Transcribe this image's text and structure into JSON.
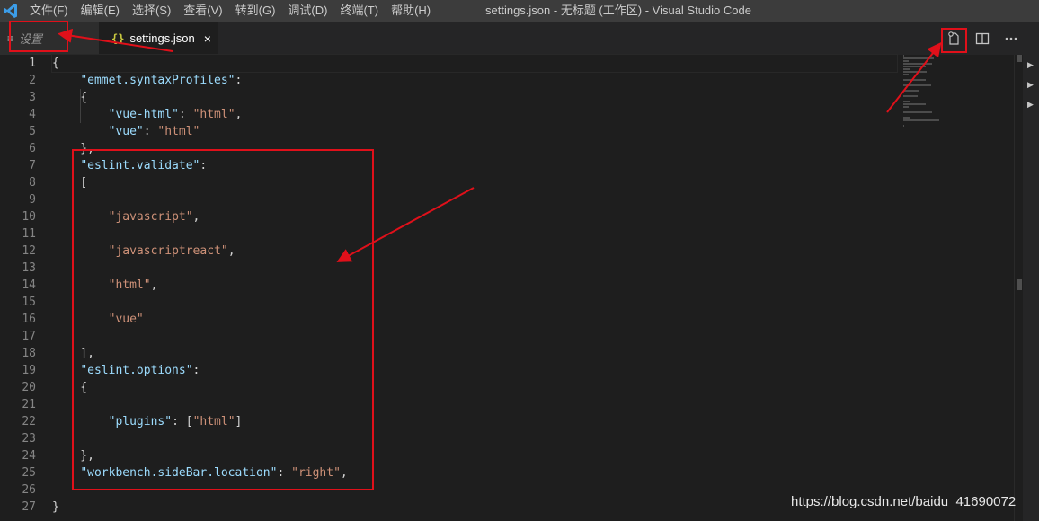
{
  "titlebar": {
    "menu": [
      "文件(F)",
      "编辑(E)",
      "选择(S)",
      "查看(V)",
      "转到(G)",
      "调试(D)",
      "终端(T)",
      "帮助(H)"
    ],
    "window_title": "settings.json - 无标题 (工作区) - Visual Studio Code"
  },
  "tabs": {
    "settings_ui": "设置",
    "settings_json": "settings.json",
    "json_icon": "{}",
    "close": "×"
  },
  "editor": {
    "line_numbers": [
      "1",
      "2",
      "3",
      "4",
      "5",
      "6",
      "7",
      "8",
      "9",
      "10",
      "11",
      "12",
      "13",
      "14",
      "15",
      "16",
      "17",
      "18",
      "19",
      "20",
      "21",
      "22",
      "23",
      "24",
      "25",
      "26",
      "27"
    ],
    "lines": [
      [
        {
          "t": "p",
          "v": "{"
        }
      ],
      [
        {
          "t": "p",
          "v": "    "
        },
        {
          "t": "k",
          "v": "\"emmet.syntaxProfiles\""
        },
        {
          "t": "p",
          "v": ": "
        }
      ],
      [
        {
          "t": "p",
          "v": "    {"
        }
      ],
      [
        {
          "t": "p",
          "v": "        "
        },
        {
          "t": "k",
          "v": "\"vue-html\""
        },
        {
          "t": "p",
          "v": ": "
        },
        {
          "t": "s",
          "v": "\"html\""
        },
        {
          "t": "p",
          "v": ","
        }
      ],
      [
        {
          "t": "p",
          "v": "        "
        },
        {
          "t": "k",
          "v": "\"vue\""
        },
        {
          "t": "p",
          "v": ": "
        },
        {
          "t": "s",
          "v": "\"html\""
        }
      ],
      [
        {
          "t": "p",
          "v": "    },"
        }
      ],
      [
        {
          "t": "p",
          "v": "    "
        },
        {
          "t": "k",
          "v": "\"eslint.validate\""
        },
        {
          "t": "p",
          "v": ":"
        }
      ],
      [
        {
          "t": "p",
          "v": "    ["
        }
      ],
      [
        {
          "t": "p",
          "v": ""
        }
      ],
      [
        {
          "t": "p",
          "v": "        "
        },
        {
          "t": "s",
          "v": "\"javascript\""
        },
        {
          "t": "p",
          "v": ","
        }
      ],
      [
        {
          "t": "p",
          "v": ""
        }
      ],
      [
        {
          "t": "p",
          "v": "        "
        },
        {
          "t": "s",
          "v": "\"javascriptreact\""
        },
        {
          "t": "p",
          "v": ","
        }
      ],
      [
        {
          "t": "p",
          "v": ""
        }
      ],
      [
        {
          "t": "p",
          "v": "        "
        },
        {
          "t": "s",
          "v": "\"html\""
        },
        {
          "t": "p",
          "v": ","
        }
      ],
      [
        {
          "t": "p",
          "v": ""
        }
      ],
      [
        {
          "t": "p",
          "v": "        "
        },
        {
          "t": "s",
          "v": "\"vue\""
        }
      ],
      [
        {
          "t": "p",
          "v": ""
        }
      ],
      [
        {
          "t": "p",
          "v": "    ],"
        }
      ],
      [
        {
          "t": "p",
          "v": "    "
        },
        {
          "t": "k",
          "v": "\"eslint.options\""
        },
        {
          "t": "p",
          "v": ":"
        }
      ],
      [
        {
          "t": "p",
          "v": "    {"
        }
      ],
      [
        {
          "t": "p",
          "v": ""
        }
      ],
      [
        {
          "t": "p",
          "v": "        "
        },
        {
          "t": "k",
          "v": "\"plugins\""
        },
        {
          "t": "p",
          "v": ": ["
        },
        {
          "t": "s",
          "v": "\"html\""
        },
        {
          "t": "p",
          "v": "]"
        }
      ],
      [
        {
          "t": "p",
          "v": ""
        }
      ],
      [
        {
          "t": "p",
          "v": "    },"
        }
      ],
      [
        {
          "t": "p",
          "v": "    "
        },
        {
          "t": "k",
          "v": "\"workbench.sideBar.location\""
        },
        {
          "t": "p",
          "v": ": "
        },
        {
          "t": "s",
          "v": "\"right\""
        },
        {
          "t": "p",
          "v": ","
        }
      ],
      [
        {
          "t": "p",
          "v": ""
        }
      ],
      [
        {
          "t": "p",
          "v": "}"
        }
      ]
    ]
  },
  "colors": {
    "key": "#9cdcfe",
    "string": "#ce9178",
    "annotation": "#e0101a",
    "accent": "#007acc"
  },
  "icons": {
    "open_settings": "open-settings-json-icon",
    "split": "split-editor-icon",
    "more": "more-actions-icon"
  },
  "watermark": "https://blog.csdn.net/baidu_41690072"
}
